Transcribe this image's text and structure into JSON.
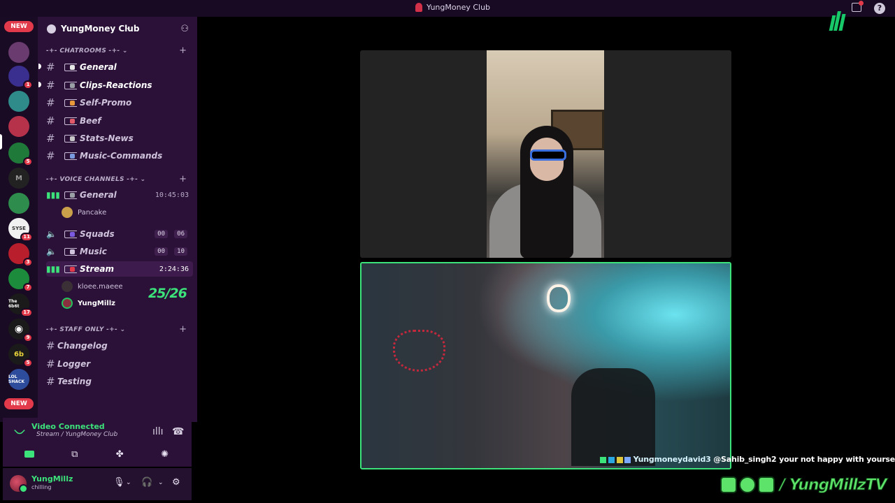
{
  "window": {
    "title": "YungMoney Club"
  },
  "rail": {
    "new_top": "NEW",
    "new_bottom": "NEW",
    "servers": [
      {
        "name": "server-1",
        "color": "#6a3b6f",
        "badge": ""
      },
      {
        "name": "server-2",
        "color": "#3a2f8f",
        "badge": "1"
      },
      {
        "name": "server-3",
        "color": "#2f8b8a",
        "badge": ""
      },
      {
        "name": "server-4",
        "color": "#b5324a",
        "badge": ""
      },
      {
        "name": "server-5",
        "color": "#1f7a3a",
        "badge": "5"
      },
      {
        "name": "server-6",
        "color": "#222222",
        "badge": ""
      },
      {
        "name": "server-7",
        "color": "#2e8c4c",
        "badge": ""
      },
      {
        "name": "server-8",
        "color": "#f1f1f1",
        "badge": "11"
      },
      {
        "name": "server-9",
        "color": "#b81e2c",
        "badge": "3"
      },
      {
        "name": "server-10",
        "color": "#1c8c3c",
        "badge": "7"
      },
      {
        "name": "server-11",
        "color": "#1a1a1a",
        "badge": "17"
      },
      {
        "name": "server-12",
        "color": "#1a1a1a",
        "badge": "9"
      },
      {
        "name": "server-13",
        "color": "#1a1a1a",
        "badge": "5"
      },
      {
        "name": "server-14",
        "color": "#2d4c9c",
        "badge": ""
      }
    ],
    "server_glyphs": {
      "s8": "SYSE",
      "s11": "The 6b6t",
      "s13": "6b",
      "s14": "LOL SHACK"
    }
  },
  "server": {
    "name": "YungMoney Club"
  },
  "categories": {
    "chatrooms": "-+- CHATROOMS -+-",
    "voice": "-+- VOICE CHANNELS -+-",
    "staff": "-+- STAFF ONLY -+-"
  },
  "text_channels": [
    {
      "label": "General",
      "emoji_color": "#e8e8e8"
    },
    {
      "label": "Clips-Reactions",
      "emoji_color": "#9aa0a6"
    },
    {
      "label": "Self-Promo",
      "emoji_color": "#e8983a"
    },
    {
      "label": "Beef",
      "emoji_color": "#e25a6a"
    },
    {
      "label": "Stats-News",
      "emoji_color": "#c8c8c8"
    },
    {
      "label": "Music-Commands",
      "emoji_color": "#7a9ae0"
    }
  ],
  "voice_channels": {
    "general": {
      "label": "General",
      "timer": "10:45:03",
      "member": "Pancake"
    },
    "squads": {
      "label": "Squads",
      "count": "00",
      "limit": "06"
    },
    "music": {
      "label": "Music",
      "count": "00",
      "limit": "10"
    },
    "stream": {
      "label": "Stream",
      "timer": "2:24:36",
      "members": [
        "kloee.maeee",
        "YungMillz"
      ]
    }
  },
  "counter": "25/26",
  "staff_channels": [
    "Changelog",
    "Logger",
    "Testing"
  ],
  "voice_status": {
    "title": "Video Connected",
    "subtitle": "Stream / YungMoney Club"
  },
  "user": {
    "name": "YungMillz",
    "status": "chilling"
  },
  "chat": {
    "username": "Yungmoneydavid3",
    "message": "@Sahib_singh2 your not happy with yourself"
  },
  "branding": {
    "handle": "/ YungMillzTV"
  },
  "colors": {
    "accent_green": "#3ce27a",
    "rail_bg": "#1a0b25",
    "panel_bg": "#2b1138",
    "notify_red": "#e23a4a"
  }
}
